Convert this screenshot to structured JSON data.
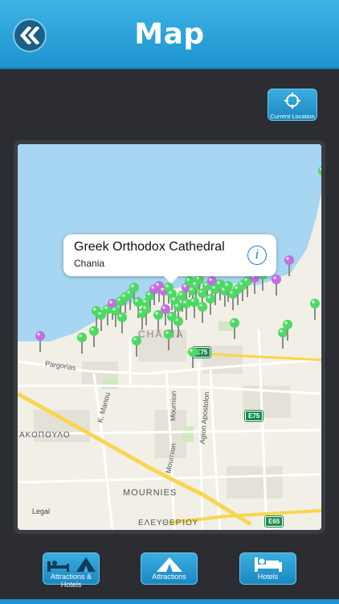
{
  "header": {
    "title": "Map",
    "back_icon": "double-chevron-left-icon"
  },
  "current_location": {
    "label": "Current Location",
    "icon": "crosshair-icon"
  },
  "callout": {
    "title": "Greek Orthodox Cathedral",
    "subtitle": "Chania",
    "info_icon": "info-icon",
    "info_glyph": "i"
  },
  "map": {
    "labels": {
      "city": "CHANIA",
      "pargorias": "Pargorias",
      "k_manou": "K. Manou",
      "mournion1": "Mournion",
      "mournion2": "Mournion",
      "agion_apostolon": "Agion Apostolon",
      "akopoulo": "ΑΚΟΠΟΥΛΟ",
      "mournies": "MOURNIES",
      "eleftheriou": "ΕΛΕΥΘΕΡΊΟΥ",
      "legal": "Legal"
    },
    "shields": {
      "e75_a": "E75",
      "e75_b": "E75",
      "e65": "E65"
    },
    "pin_colors": {
      "green": "#4cd964",
      "purple": "#c36ee0"
    }
  },
  "bottom_bar": {
    "attractions_hotels": {
      "label": "Attractions & Hotels",
      "icon": "bed-and-tent-icon"
    },
    "attractions": {
      "label": "Attractions",
      "icon": "tent-icon"
    },
    "hotels": {
      "label": "Hotels",
      "icon": "bed-icon"
    }
  }
}
